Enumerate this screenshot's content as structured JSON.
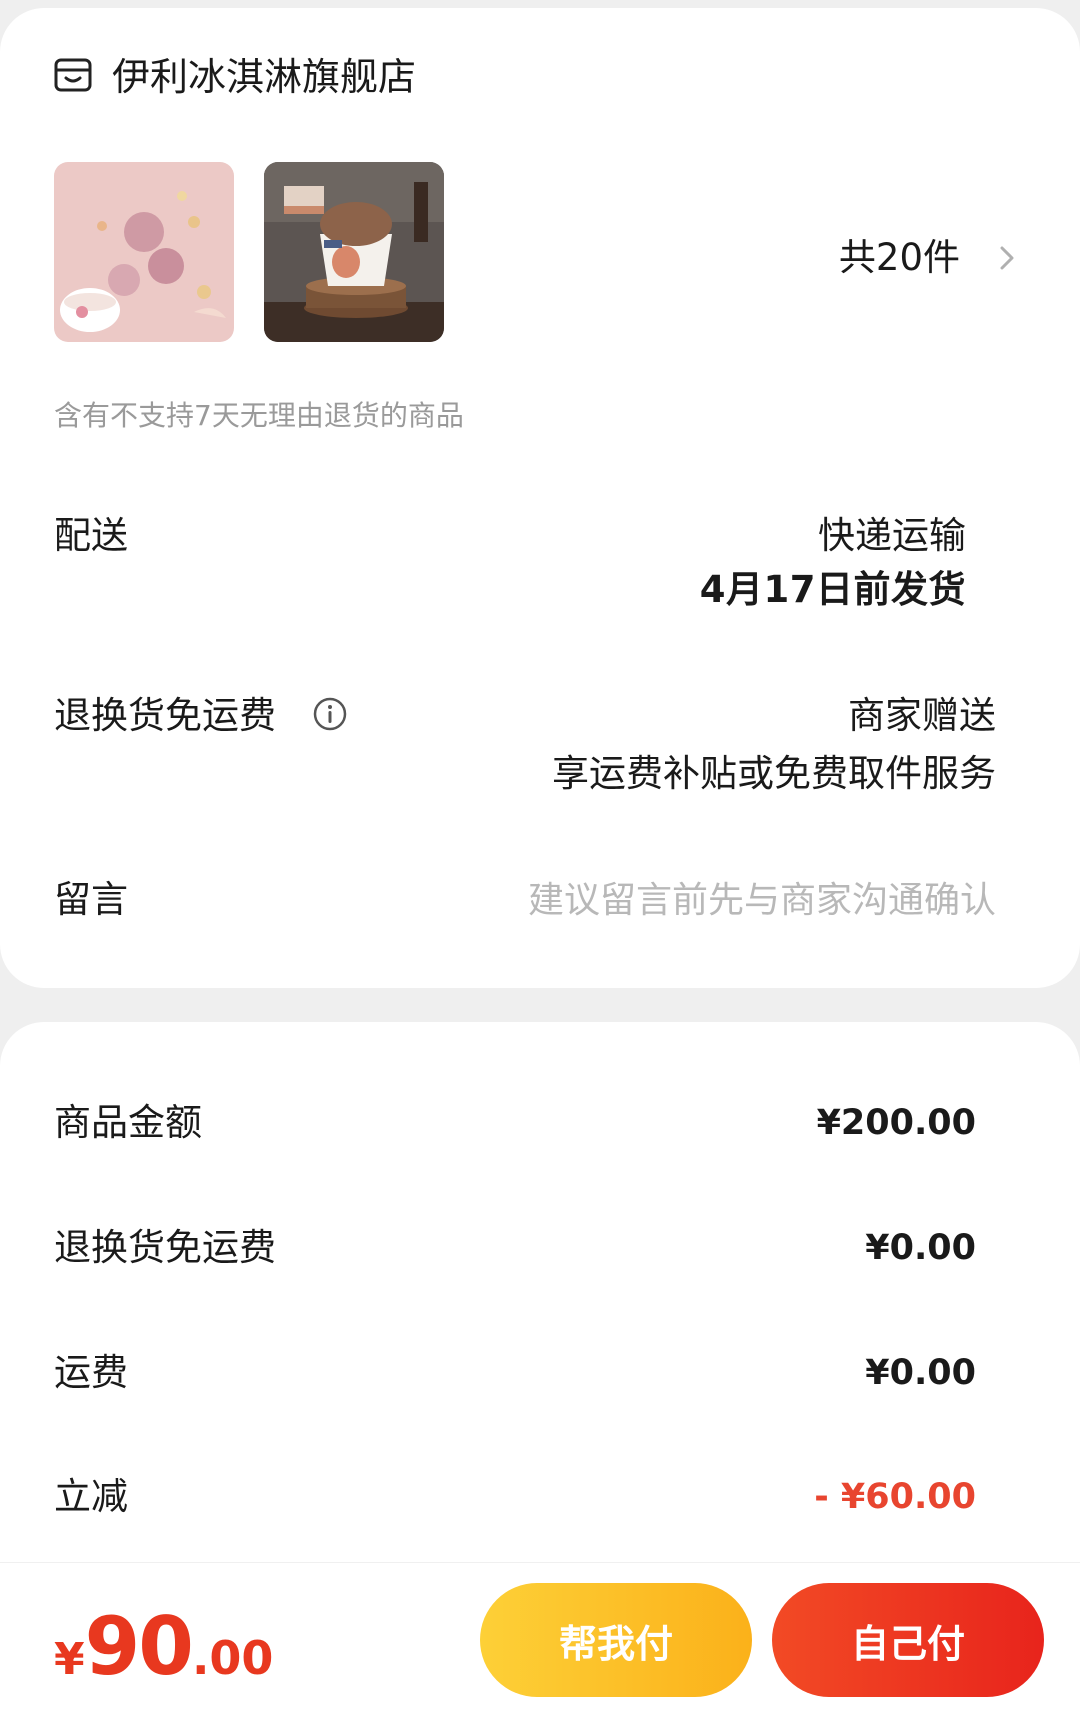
{
  "store": {
    "icon": "shop-icon",
    "name": "伊利冰淇淋旗舰店"
  },
  "products": {
    "thumbnails": [
      {
        "alt": "product-thumbnail-1"
      },
      {
        "alt": "product-thumbnail-2"
      }
    ],
    "count_label": "共20件",
    "chevron_icon": "chevron-right-icon",
    "notice": "含有不支持7天无理由退货的商品"
  },
  "delivery": {
    "label": "配送",
    "method": "快递运输",
    "date": "4月17日前发货"
  },
  "return_shipping": {
    "label": "退换货免运费",
    "info_icon": "info-icon",
    "value": "商家赠送",
    "detail": "享运费补贴或免费取件服务"
  },
  "message": {
    "label": "留言",
    "placeholder": "建议留言前先与商家沟通确认",
    "value": ""
  },
  "price_breakdown": [
    {
      "label": "商品金额",
      "value": "¥200.00"
    },
    {
      "label": "退换货免运费",
      "value": "¥0.00"
    },
    {
      "label": "运费",
      "value": "¥0.00"
    },
    {
      "label": "立减",
      "value": "- ¥60.00"
    }
  ],
  "bottom_bar": {
    "total_symbol": "¥",
    "total_integer": "90",
    "total_decimal": ".00",
    "help_pay_label": "帮我付",
    "self_pay_label": "自己付"
  },
  "colors": {
    "accent_red": "#e8381f",
    "discount_red": "#e8452f",
    "help_button": "#fcc12a",
    "pay_button": "#ec3520"
  }
}
